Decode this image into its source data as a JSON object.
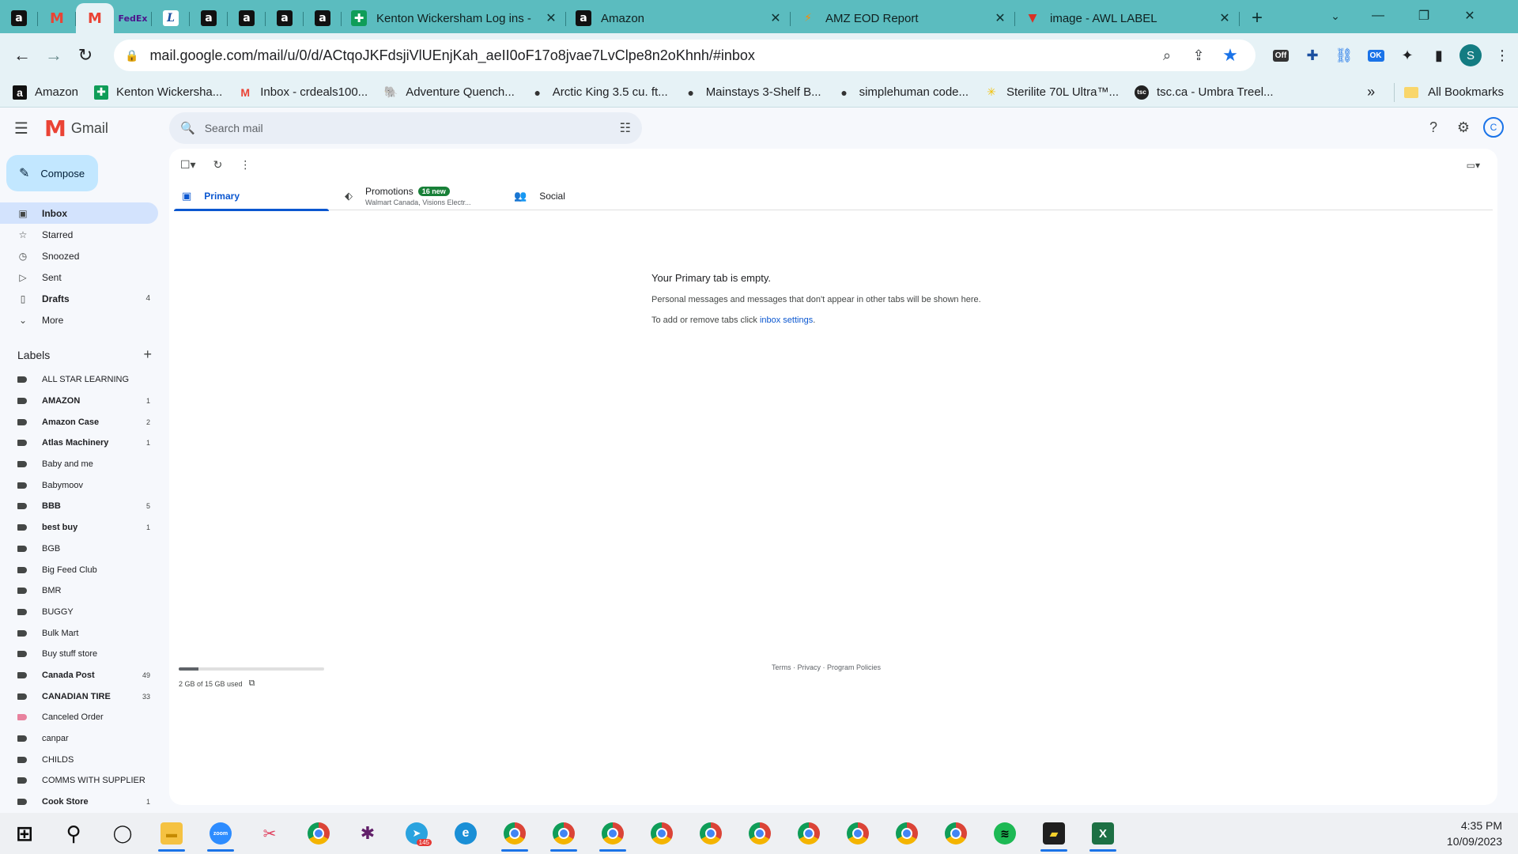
{
  "browser": {
    "pinned_tabs": [
      {
        "icon": "amazon-icon",
        "glyph": "a"
      },
      {
        "icon": "gmail-icon",
        "glyph": "M"
      },
      {
        "icon": "gmail-icon",
        "glyph": "M",
        "active": true
      },
      {
        "icon": "fedex-icon",
        "glyph": "FedEx"
      },
      {
        "icon": "l-logo-icon",
        "glyph": "L"
      },
      {
        "icon": "amazon-icon",
        "glyph": "a"
      },
      {
        "icon": "amazon-icon",
        "glyph": "a"
      },
      {
        "icon": "amazon-icon",
        "glyph": "a"
      },
      {
        "icon": "amazon-icon",
        "glyph": "a"
      }
    ],
    "tabs": [
      {
        "title": "Kenton Wickersham Log ins -",
        "icon": "sheets-icon"
      },
      {
        "title": "Amazon",
        "icon": "amazon-icon"
      },
      {
        "title": "AMZ EOD Report",
        "icon": "amz-icon"
      },
      {
        "title": "image - AWL LABEL",
        "icon": "awl-icon"
      }
    ],
    "url": "mail.google.com/mail/u/0/d/ACtqoJKFdsjiVlUEnjKah_aeII0oF17o8jvae7LvClpe8n2oKhnh/#inbox",
    "profile_initial": "S",
    "ext_off_label": "Off",
    "ext_ok_label": "OK",
    "bookmarks": [
      {
        "label": "Amazon",
        "icon": "amazon-icon"
      },
      {
        "label": "Kenton Wickersha...",
        "icon": "sheets-icon"
      },
      {
        "label": "Inbox - crdeals100...",
        "icon": "gmail-icon"
      },
      {
        "label": "Adventure Quench...",
        "icon": "elephant-icon"
      },
      {
        "label": "Arctic King 3.5 cu. ft...",
        "icon": "globe-icon"
      },
      {
        "label": "Mainstays 3-Shelf B...",
        "icon": "globe-icon"
      },
      {
        "label": "simplehuman code...",
        "icon": "globe-icon"
      },
      {
        "label": "Sterilite 70L Ultra™...",
        "icon": "walmart-icon"
      },
      {
        "label": "tsc.ca - Umbra Treel...",
        "icon": "tsc-icon"
      }
    ],
    "all_bookmarks": "All Bookmarks"
  },
  "gmail": {
    "product_name": "Gmail",
    "search_placeholder": "Search mail",
    "compose": "Compose",
    "account_initial": "C",
    "folders": [
      {
        "label": "Inbox",
        "icon": "inbox-icon",
        "active": true,
        "count": ""
      },
      {
        "label": "Starred",
        "icon": "star-icon",
        "count": ""
      },
      {
        "label": "Snoozed",
        "icon": "clock-icon",
        "count": ""
      },
      {
        "label": "Sent",
        "icon": "send-icon",
        "count": ""
      },
      {
        "label": "Drafts",
        "icon": "draft-icon",
        "count": "4",
        "bold": true
      },
      {
        "label": "More",
        "icon": "chevron-down-icon",
        "count": ""
      }
    ],
    "labels_heading": "Labels",
    "labels": [
      {
        "name": "ALL STAR LEARNING",
        "count": ""
      },
      {
        "name": "AMAZON",
        "count": "1",
        "bold": true
      },
      {
        "name": "Amazon Case",
        "count": "2",
        "bold": true
      },
      {
        "name": "Atlas Machinery",
        "count": "1",
        "bold": true
      },
      {
        "name": "Baby and me",
        "count": ""
      },
      {
        "name": "Babymoov",
        "count": ""
      },
      {
        "name": "BBB",
        "count": "5",
        "bold": true
      },
      {
        "name": "best buy",
        "count": "1",
        "bold": true
      },
      {
        "name": "BGB",
        "count": ""
      },
      {
        "name": "Big Feed Club",
        "count": ""
      },
      {
        "name": "BMR",
        "count": ""
      },
      {
        "name": "BUGGY",
        "count": ""
      },
      {
        "name": "Bulk Mart",
        "count": ""
      },
      {
        "name": "Buy stuff store",
        "count": ""
      },
      {
        "name": "Canada Post",
        "count": "49",
        "bold": true
      },
      {
        "name": "CANADIAN TIRE",
        "count": "33",
        "bold": true
      },
      {
        "name": "Canceled Order",
        "count": "",
        "color": "#e8829e"
      },
      {
        "name": "canpar",
        "count": ""
      },
      {
        "name": "CHILDS",
        "count": ""
      },
      {
        "name": "COMMS WITH SUPPLIER",
        "count": ""
      },
      {
        "name": "Cook Store",
        "count": "1",
        "bold": true
      }
    ],
    "tabs": {
      "primary": "Primary",
      "promotions": "Promotions",
      "promotions_badge": "16 new",
      "promotions_senders": "Walmart Canada, Visions Electr...",
      "social": "Social"
    },
    "empty": {
      "title": "Your Primary tab is empty.",
      "line1": "Personal messages and messages that don't appear in other tabs will be shown here.",
      "line2_prefix": "To add or remove tabs click ",
      "line2_link": "inbox settings",
      "line2_suffix": "."
    },
    "storage": {
      "used_text": "2 GB of 15 GB used",
      "fraction": 0.1333
    },
    "footer": "Terms · Privacy · Program Policies"
  },
  "taskbar": {
    "apps": [
      {
        "icon": "windows-start-icon"
      },
      {
        "icon": "search-icon"
      },
      {
        "icon": "task-view-icon"
      },
      {
        "icon": "file-explorer-icon",
        "running": true
      },
      {
        "icon": "zoom-icon",
        "running": true
      },
      {
        "icon": "snipping-tool-icon"
      },
      {
        "icon": "chrome-icon"
      },
      {
        "icon": "slack-icon"
      },
      {
        "icon": "telegram-icon",
        "badge": "145"
      },
      {
        "icon": "edge-icon"
      },
      {
        "icon": "chrome-icon",
        "running": true
      },
      {
        "icon": "chrome-icon",
        "running": true
      },
      {
        "icon": "chrome-icon",
        "running": true
      },
      {
        "icon": "chrome-icon"
      },
      {
        "icon": "chrome-icon"
      },
      {
        "icon": "chrome-icon"
      },
      {
        "icon": "chrome-icon"
      },
      {
        "icon": "chrome-icon"
      },
      {
        "icon": "chrome-icon"
      },
      {
        "icon": "chrome-icon"
      },
      {
        "icon": "spotify-icon"
      },
      {
        "icon": "sticky-notes-icon",
        "running": true
      },
      {
        "icon": "excel-icon",
        "running": true
      }
    ],
    "time": "4:35 PM",
    "date": "10/09/2023"
  }
}
